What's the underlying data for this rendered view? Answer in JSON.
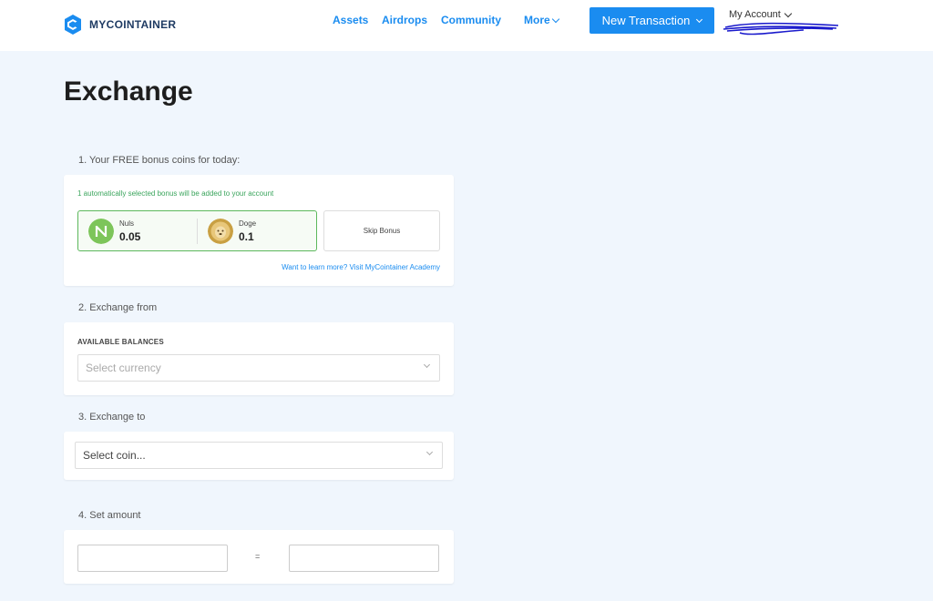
{
  "header": {
    "logo_text": "MYCOINTAINER",
    "nav": {
      "assets": "Assets",
      "airdrops": "Airdrops",
      "community": "Community",
      "more": "More"
    },
    "new_transaction": "New Transaction",
    "account_label": "My Account"
  },
  "page": {
    "title": "Exchange"
  },
  "bonus": {
    "step_label": "1. Your FREE bonus coins for today:",
    "note": "1 automatically selected bonus will be added to your account",
    "coins": [
      {
        "name": "Nuls",
        "amount": "0.05",
        "icon": "nuls-icon"
      },
      {
        "name": "Doge",
        "amount": "0.1",
        "icon": "doge-icon"
      }
    ],
    "skip_label": "Skip Bonus",
    "learn_more": "Want to learn more? Visit MyCointainer Academy"
  },
  "exchange_from": {
    "step_label": "2. Exchange from",
    "balances_label": "AVAILABLE BALANCES",
    "select_placeholder": "Select currency"
  },
  "exchange_to": {
    "step_label": "3. Exchange to",
    "select_placeholder": "Select coin..."
  },
  "amount": {
    "step_label": "4. Set amount",
    "equals": "="
  },
  "colors": {
    "accent": "#1a8cf0",
    "bonus_green": "#3ba55d",
    "page_bg": "#f0f6fd"
  }
}
